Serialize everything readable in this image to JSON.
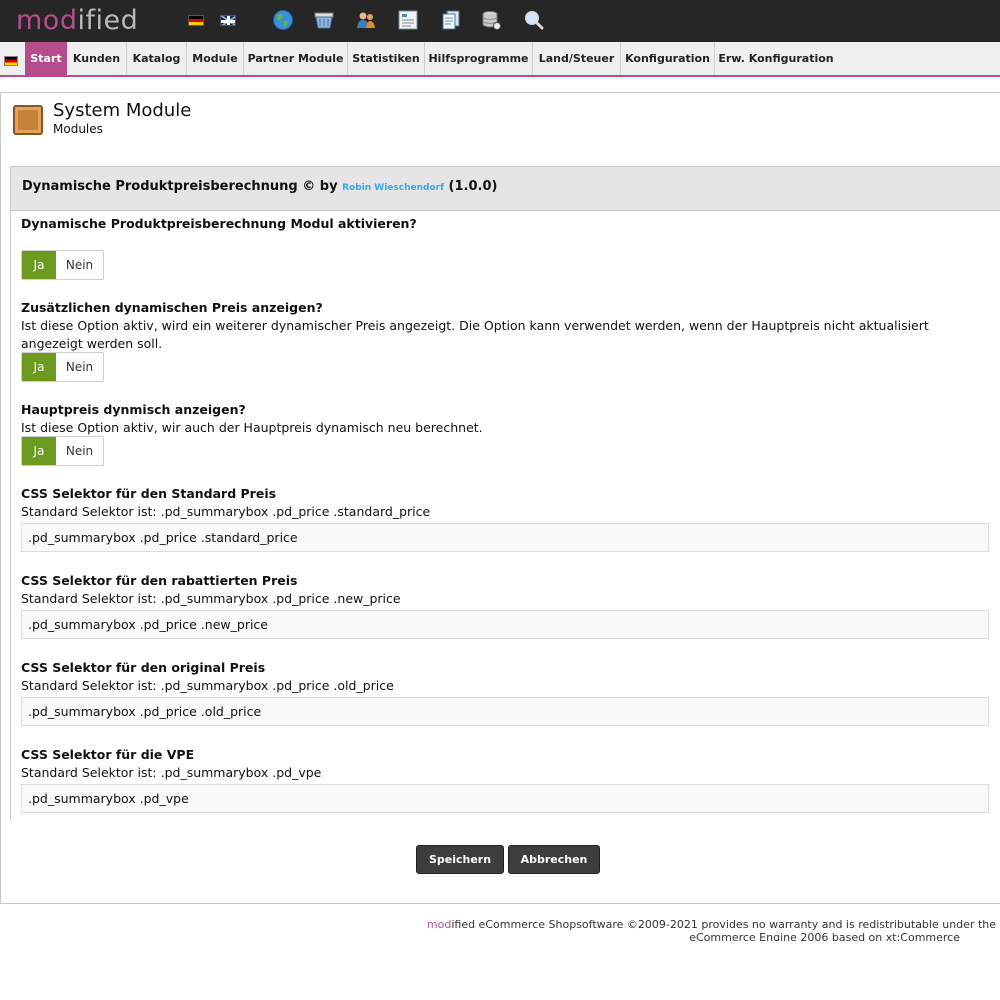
{
  "logo": {
    "part1": "mod",
    "part2": "ified"
  },
  "toolbar_icons": [
    "globe-icon",
    "basket-icon",
    "customers-icon",
    "report-icon",
    "copy-icon",
    "database-icon",
    "search-icon"
  ],
  "nav": {
    "items": [
      "Start",
      "Kunden",
      "Katalog",
      "Module",
      "Partner Module",
      "Statistiken",
      "Hilfsprogramme",
      "Land/Steuer",
      "Konfiguration",
      "Erw. Konfiguration"
    ],
    "active": "Start"
  },
  "page": {
    "title": "System Module",
    "subtitle": "Modules"
  },
  "module": {
    "name": "Dynamische Produktpreisberechnung © by",
    "author": "Robin Wieschendorf",
    "version": "(1.0.0)"
  },
  "options": [
    {
      "title": "Dynamische Produktpreisberechnung Modul aktivieren?",
      "desc": "",
      "yes": "Ja",
      "no": "Nein",
      "selected": "Ja"
    },
    {
      "title": "Zusätzlichen dynamischen Preis anzeigen?",
      "desc": "Ist diese Option aktiv, wird ein weiterer dynamischer Preis angezeigt. Die Option kann verwendet werden, wenn der Hauptpreis nicht aktualisiert angezeigt werden soll.",
      "yes": "Ja",
      "no": "Nein",
      "selected": "Ja"
    },
    {
      "title": "Hauptpreis dynmisch anzeigen?",
      "desc": "Ist diese Option aktiv, wir auch der Hauptpreis dynamisch neu berechnet.",
      "yes": "Ja",
      "no": "Nein",
      "selected": "Ja"
    }
  ],
  "fields": [
    {
      "title": "CSS Selektor für den Standard Preis",
      "desc": "Standard Selektor ist: .pd_summarybox .pd_price .standard_price",
      "value": ".pd_summarybox .pd_price .standard_price"
    },
    {
      "title": "CSS Selektor für den rabattierten Preis",
      "desc": "Standard Selektor ist: .pd_summarybox .pd_price .new_price",
      "value": ".pd_summarybox .pd_price .new_price"
    },
    {
      "title": "CSS Selektor für den original Preis",
      "desc": "Standard Selektor ist: .pd_summarybox .pd_price .old_price",
      "value": ".pd_summarybox .pd_price .old_price"
    },
    {
      "title": "CSS Selektor für die VPE",
      "desc": "Standard Selektor ist: .pd_summarybox .pd_vpe",
      "value": ".pd_summarybox .pd_vpe"
    }
  ],
  "buttons": {
    "save": "Speichern",
    "cancel": "Abbrechen"
  },
  "footer": {
    "brand": "mod",
    "line1_rest": "ified eCommerce Shopsoftware ©2009-2021 provides no warranty and is redistributable under the",
    "line2": "eCommerce Engine 2006 based on xt:Commerce"
  },
  "colors": {
    "accent": "#b54d8d",
    "toggle_on": "#6b9a1f",
    "author_link": "#37a8e8"
  }
}
